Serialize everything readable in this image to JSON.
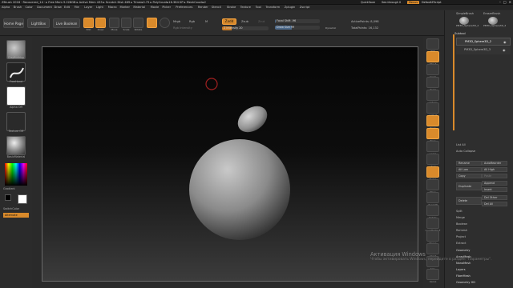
{
  "titlebar": {
    "text": "ZBrush 2018 · Recovered_14 · ▸ Free Mem 9.228GB ▸ Active Mem 433 ▸ Scratch Disk 469 ▸ Timer▸0.75 ▸ PolyCount▸16.384 KP ▸ MeshCount▸2",
    "quicksave": "QuickSave",
    "seethrough": "See-through 0",
    "menus": "Menus",
    "default_zscript": "DefaultZScript"
  },
  "menubar": [
    "Alpha",
    "Brush",
    "Color",
    "Document",
    "Draw",
    "Edit",
    "File",
    "Layer",
    "Light",
    "Macro",
    "Marker",
    "Material",
    "Movie",
    "Picker",
    "Preferences",
    "Render",
    "Stencil",
    "Stroke",
    "Texture",
    "Tool",
    "Transform",
    "Zplugin",
    "Zscript"
  ],
  "toolbar": {
    "home_page": "Home Page",
    "lightbox": "LightBox",
    "live_boolean": "Live Boolean",
    "edit": "Edit",
    "draw": "Draw",
    "move": "Move",
    "scale": "Scale",
    "rotate": "Rotate",
    "mrgb": "Mrgb",
    "rgb": "Rgb",
    "m": "M",
    "zadd": "Zadd",
    "zsub": "Zsub",
    "zcut": "Zcut",
    "rgb_intensity": "Rgb Intensity",
    "z_intensity": "Z Intensity 20",
    "focal_shift": "Focal Shift -96",
    "draw_size": "Draw Size 99",
    "dynamic": "Dynamic",
    "active_points": "ActivePoints: 8,098",
    "total_points": "TotalPoints: 16,132"
  },
  "leftshelf": {
    "brush_label": "ClayBuildup",
    "stroke_label": "FreeHand",
    "alpha_label": "Alpha Off",
    "texture_label": "Texture Off",
    "material_label": "BasicMaterial",
    "gradient_label": "Gradient",
    "switchcolor_label": "SwitchColor",
    "alternate_label": "Alternate"
  },
  "rightcol": [
    "BPR",
    "SPix 3",
    "Scroll",
    "Zoom",
    "Actual",
    "AAHalf",
    "Persp",
    "Floor",
    "Local",
    "LSym",
    "Frame",
    "Move",
    "Zoom3D",
    "Rotate",
    "Line Fill PolyF",
    "Transp",
    "Ghost",
    "Solo",
    "Xpose"
  ],
  "rightpanel": {
    "simplebrush": "SimpleBrush",
    "eraserbrush": "EraserBrush",
    "pm3d_sphere_top": "PM3D_Sphere3D_2",
    "subtool": "Subtool",
    "subtool_items": [
      "PM3D_Sphere3D_2",
      "PM3D_Sphere3D_3"
    ],
    "list_all": "List All",
    "auto_collapse": "Auto Collapse",
    "rename": "Rename",
    "auto_reorder": "AutoReorder",
    "all_low": "All Low",
    "all_high": "All High",
    "copy": "Copy",
    "paste": "Paste",
    "duplicate": "Duplicate",
    "append": "Append",
    "insert": "Insert",
    "delete": "Delete",
    "del_other": "Del Other",
    "del_all": "Del All",
    "split": "Split",
    "merge": "Merge",
    "boolean": "Boolean",
    "remesh": "Remesh",
    "project": "Project",
    "extract": "Extract",
    "bottom_menus": [
      "Geometry",
      "ArrayMesh",
      "NanoMesh",
      "Layers",
      "FiberMesh",
      "Geometry HD"
    ]
  },
  "watermark": {
    "line1": "Активация Windows",
    "line2": "Чтобы активировать Windows, перейдите в раздел \"Параметры\"."
  },
  "colors": {
    "accent": "#d98a2b",
    "panel": "#2e2e2e",
    "canvas": "#0a0a0a"
  }
}
